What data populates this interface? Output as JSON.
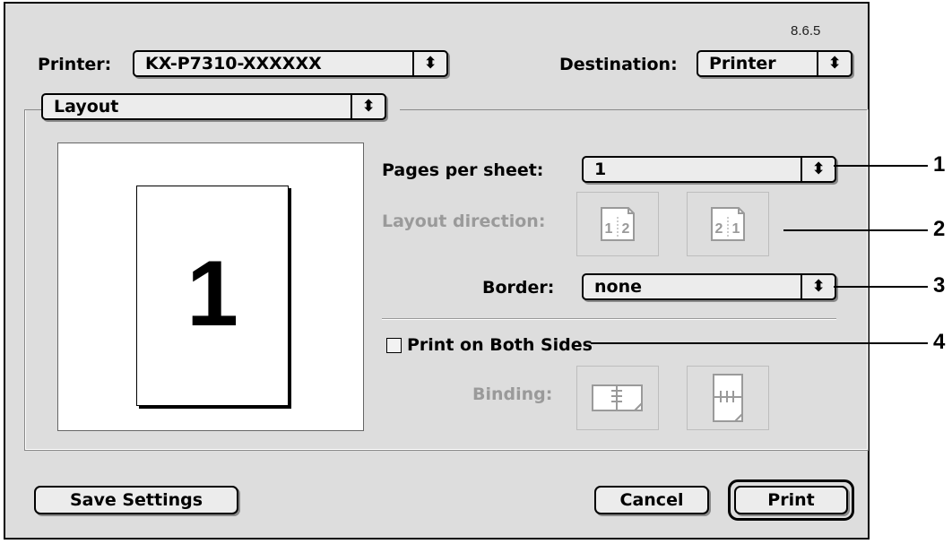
{
  "version": "8.6.5",
  "printer": {
    "label": "Printer:",
    "value": "KX-P7310-XXXXXX"
  },
  "destination": {
    "label": "Destination:",
    "value": "Printer"
  },
  "panel": {
    "value": "Layout"
  },
  "preview": {
    "page_number": "1"
  },
  "pages_per_sheet": {
    "label": "Pages per sheet:",
    "value": "1"
  },
  "layout_direction": {
    "label": "Layout direction:",
    "option1": "1 2",
    "option2": "2 1"
  },
  "border": {
    "label": "Border:",
    "value": "none"
  },
  "duplex": {
    "label": "Print on Both Sides",
    "checked": false
  },
  "binding": {
    "label": "Binding:"
  },
  "buttons": {
    "save": "Save Settings",
    "cancel": "Cancel",
    "print": "Print"
  },
  "callouts": [
    "1",
    "2",
    "3",
    "4"
  ],
  "icons": {
    "stepper": "up-down-arrows-icon"
  },
  "colors": {
    "dialog_bg": "#dddddd",
    "disabled_text": "#9a9a9a"
  }
}
